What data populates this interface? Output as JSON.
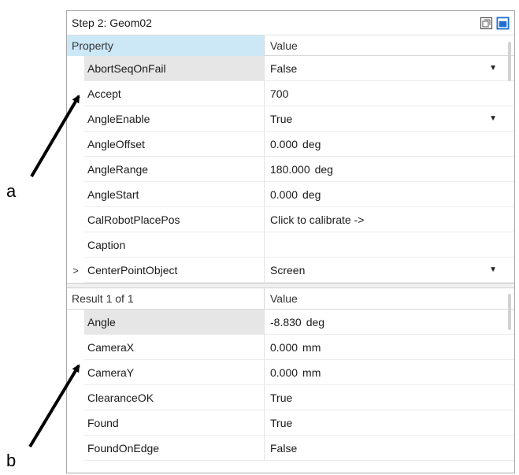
{
  "window": {
    "title": "Step 2: Geom02"
  },
  "icons": {
    "toolbar_left": "window-restore-icon",
    "toolbar_right": "pin-icon",
    "accent": "#1f6fd0"
  },
  "properties": {
    "header_name": "Property",
    "header_value": "Value",
    "rows": [
      {
        "name": "AbortSeqOnFail",
        "value": "False",
        "unit": "",
        "dropdown": true,
        "expand": ""
      },
      {
        "name": "Accept",
        "value": "700",
        "unit": "",
        "dropdown": false,
        "expand": ""
      },
      {
        "name": "AngleEnable",
        "value": "True",
        "unit": "",
        "dropdown": true,
        "expand": ""
      },
      {
        "name": "AngleOffset",
        "value": "0.000",
        "unit": "deg",
        "dropdown": false,
        "expand": ""
      },
      {
        "name": "AngleRange",
        "value": "180.000",
        "unit": "deg",
        "dropdown": false,
        "expand": ""
      },
      {
        "name": "AngleStart",
        "value": "0.000",
        "unit": "deg",
        "dropdown": false,
        "expand": ""
      },
      {
        "name": "CalRobotPlacePos",
        "value": "Click to calibrate ->",
        "unit": "",
        "dropdown": false,
        "expand": ""
      },
      {
        "name": "Caption",
        "value": "",
        "unit": "",
        "dropdown": false,
        "expand": ""
      },
      {
        "name": "CenterPointObject",
        "value": "Screen",
        "unit": "",
        "dropdown": true,
        "expand": ">"
      }
    ]
  },
  "results": {
    "header_name": "Result 1 of 1",
    "header_value": "Value",
    "rows": [
      {
        "name": "Angle",
        "value": "-8.830",
        "unit": "deg",
        "selected": true
      },
      {
        "name": "CameraX",
        "value": "0.000",
        "unit": "mm",
        "selected": false
      },
      {
        "name": "CameraY",
        "value": "0.000",
        "unit": "mm",
        "selected": false
      },
      {
        "name": "ClearanceOK",
        "value": "True",
        "unit": "",
        "selected": false
      },
      {
        "name": "Found",
        "value": "True",
        "unit": "",
        "selected": false
      },
      {
        "name": "FoundOnEdge",
        "value": "False",
        "unit": "",
        "selected": false
      }
    ]
  },
  "callouts": {
    "a": "a",
    "b": "b"
  }
}
